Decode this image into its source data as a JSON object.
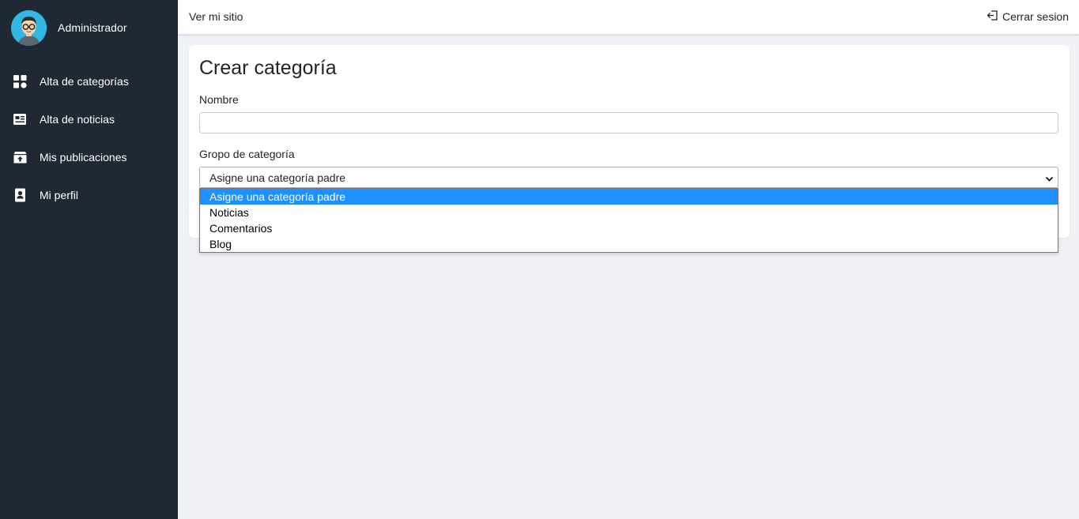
{
  "sidebar": {
    "profile": {
      "name": "Administrador"
    },
    "items": [
      {
        "label": "Alta de categorías",
        "icon": "dashboard-icon"
      },
      {
        "label": "Alta de noticias",
        "icon": "newspaper-icon"
      },
      {
        "label": "Mis publicaciones",
        "icon": "archive-upload-icon"
      },
      {
        "label": "Mi perfil",
        "icon": "contact-card-icon"
      }
    ]
  },
  "topbar": {
    "site_link": "Ver mi sitio",
    "logout_label": "Cerrar sesion"
  },
  "form": {
    "title": "Crear categoría",
    "name_label": "Nombre",
    "name_value": "",
    "group_label": "Gropo de categoría",
    "group_selected": "Asigne una categoría padre",
    "group_options": [
      "Asigne una categoría padre",
      "Noticias",
      "Comentarios",
      "Blog"
    ]
  },
  "colors": {
    "sidebar_bg": "#1e2933",
    "page_bg": "#eff1f5",
    "selected_option": "#1e90ff",
    "avatar_bg": "#33b7e3"
  }
}
